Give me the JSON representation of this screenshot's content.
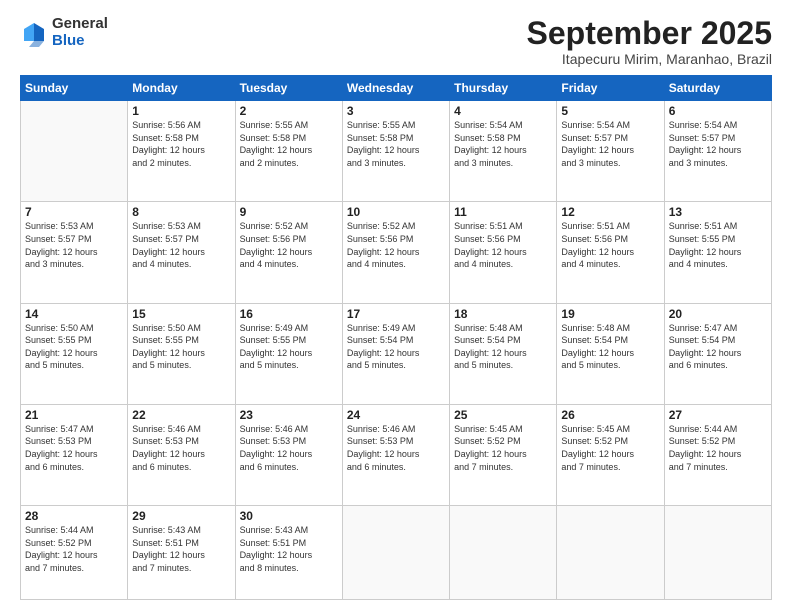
{
  "logo": {
    "general": "General",
    "blue": "Blue"
  },
  "header": {
    "title": "September 2025",
    "subtitle": "Itapecuru Mirim, Maranhao, Brazil"
  },
  "weekdays": [
    "Sunday",
    "Monday",
    "Tuesday",
    "Wednesday",
    "Thursday",
    "Friday",
    "Saturday"
  ],
  "weeks": [
    [
      {
        "day": "",
        "info": ""
      },
      {
        "day": "1",
        "info": "Sunrise: 5:56 AM\nSunset: 5:58 PM\nDaylight: 12 hours\nand 2 minutes."
      },
      {
        "day": "2",
        "info": "Sunrise: 5:55 AM\nSunset: 5:58 PM\nDaylight: 12 hours\nand 2 minutes."
      },
      {
        "day": "3",
        "info": "Sunrise: 5:55 AM\nSunset: 5:58 PM\nDaylight: 12 hours\nand 3 minutes."
      },
      {
        "day": "4",
        "info": "Sunrise: 5:54 AM\nSunset: 5:58 PM\nDaylight: 12 hours\nand 3 minutes."
      },
      {
        "day": "5",
        "info": "Sunrise: 5:54 AM\nSunset: 5:57 PM\nDaylight: 12 hours\nand 3 minutes."
      },
      {
        "day": "6",
        "info": "Sunrise: 5:54 AM\nSunset: 5:57 PM\nDaylight: 12 hours\nand 3 minutes."
      }
    ],
    [
      {
        "day": "7",
        "info": "Sunrise: 5:53 AM\nSunset: 5:57 PM\nDaylight: 12 hours\nand 3 minutes."
      },
      {
        "day": "8",
        "info": "Sunrise: 5:53 AM\nSunset: 5:57 PM\nDaylight: 12 hours\nand 4 minutes."
      },
      {
        "day": "9",
        "info": "Sunrise: 5:52 AM\nSunset: 5:56 PM\nDaylight: 12 hours\nand 4 minutes."
      },
      {
        "day": "10",
        "info": "Sunrise: 5:52 AM\nSunset: 5:56 PM\nDaylight: 12 hours\nand 4 minutes."
      },
      {
        "day": "11",
        "info": "Sunrise: 5:51 AM\nSunset: 5:56 PM\nDaylight: 12 hours\nand 4 minutes."
      },
      {
        "day": "12",
        "info": "Sunrise: 5:51 AM\nSunset: 5:56 PM\nDaylight: 12 hours\nand 4 minutes."
      },
      {
        "day": "13",
        "info": "Sunrise: 5:51 AM\nSunset: 5:55 PM\nDaylight: 12 hours\nand 4 minutes."
      }
    ],
    [
      {
        "day": "14",
        "info": "Sunrise: 5:50 AM\nSunset: 5:55 PM\nDaylight: 12 hours\nand 5 minutes."
      },
      {
        "day": "15",
        "info": "Sunrise: 5:50 AM\nSunset: 5:55 PM\nDaylight: 12 hours\nand 5 minutes."
      },
      {
        "day": "16",
        "info": "Sunrise: 5:49 AM\nSunset: 5:55 PM\nDaylight: 12 hours\nand 5 minutes."
      },
      {
        "day": "17",
        "info": "Sunrise: 5:49 AM\nSunset: 5:54 PM\nDaylight: 12 hours\nand 5 minutes."
      },
      {
        "day": "18",
        "info": "Sunrise: 5:48 AM\nSunset: 5:54 PM\nDaylight: 12 hours\nand 5 minutes."
      },
      {
        "day": "19",
        "info": "Sunrise: 5:48 AM\nSunset: 5:54 PM\nDaylight: 12 hours\nand 5 minutes."
      },
      {
        "day": "20",
        "info": "Sunrise: 5:47 AM\nSunset: 5:54 PM\nDaylight: 12 hours\nand 6 minutes."
      }
    ],
    [
      {
        "day": "21",
        "info": "Sunrise: 5:47 AM\nSunset: 5:53 PM\nDaylight: 12 hours\nand 6 minutes."
      },
      {
        "day": "22",
        "info": "Sunrise: 5:46 AM\nSunset: 5:53 PM\nDaylight: 12 hours\nand 6 minutes."
      },
      {
        "day": "23",
        "info": "Sunrise: 5:46 AM\nSunset: 5:53 PM\nDaylight: 12 hours\nand 6 minutes."
      },
      {
        "day": "24",
        "info": "Sunrise: 5:46 AM\nSunset: 5:53 PM\nDaylight: 12 hours\nand 6 minutes."
      },
      {
        "day": "25",
        "info": "Sunrise: 5:45 AM\nSunset: 5:52 PM\nDaylight: 12 hours\nand 7 minutes."
      },
      {
        "day": "26",
        "info": "Sunrise: 5:45 AM\nSunset: 5:52 PM\nDaylight: 12 hours\nand 7 minutes."
      },
      {
        "day": "27",
        "info": "Sunrise: 5:44 AM\nSunset: 5:52 PM\nDaylight: 12 hours\nand 7 minutes."
      }
    ],
    [
      {
        "day": "28",
        "info": "Sunrise: 5:44 AM\nSunset: 5:52 PM\nDaylight: 12 hours\nand 7 minutes."
      },
      {
        "day": "29",
        "info": "Sunrise: 5:43 AM\nSunset: 5:51 PM\nDaylight: 12 hours\nand 7 minutes."
      },
      {
        "day": "30",
        "info": "Sunrise: 5:43 AM\nSunset: 5:51 PM\nDaylight: 12 hours\nand 8 minutes."
      },
      {
        "day": "",
        "info": ""
      },
      {
        "day": "",
        "info": ""
      },
      {
        "day": "",
        "info": ""
      },
      {
        "day": "",
        "info": ""
      }
    ]
  ]
}
